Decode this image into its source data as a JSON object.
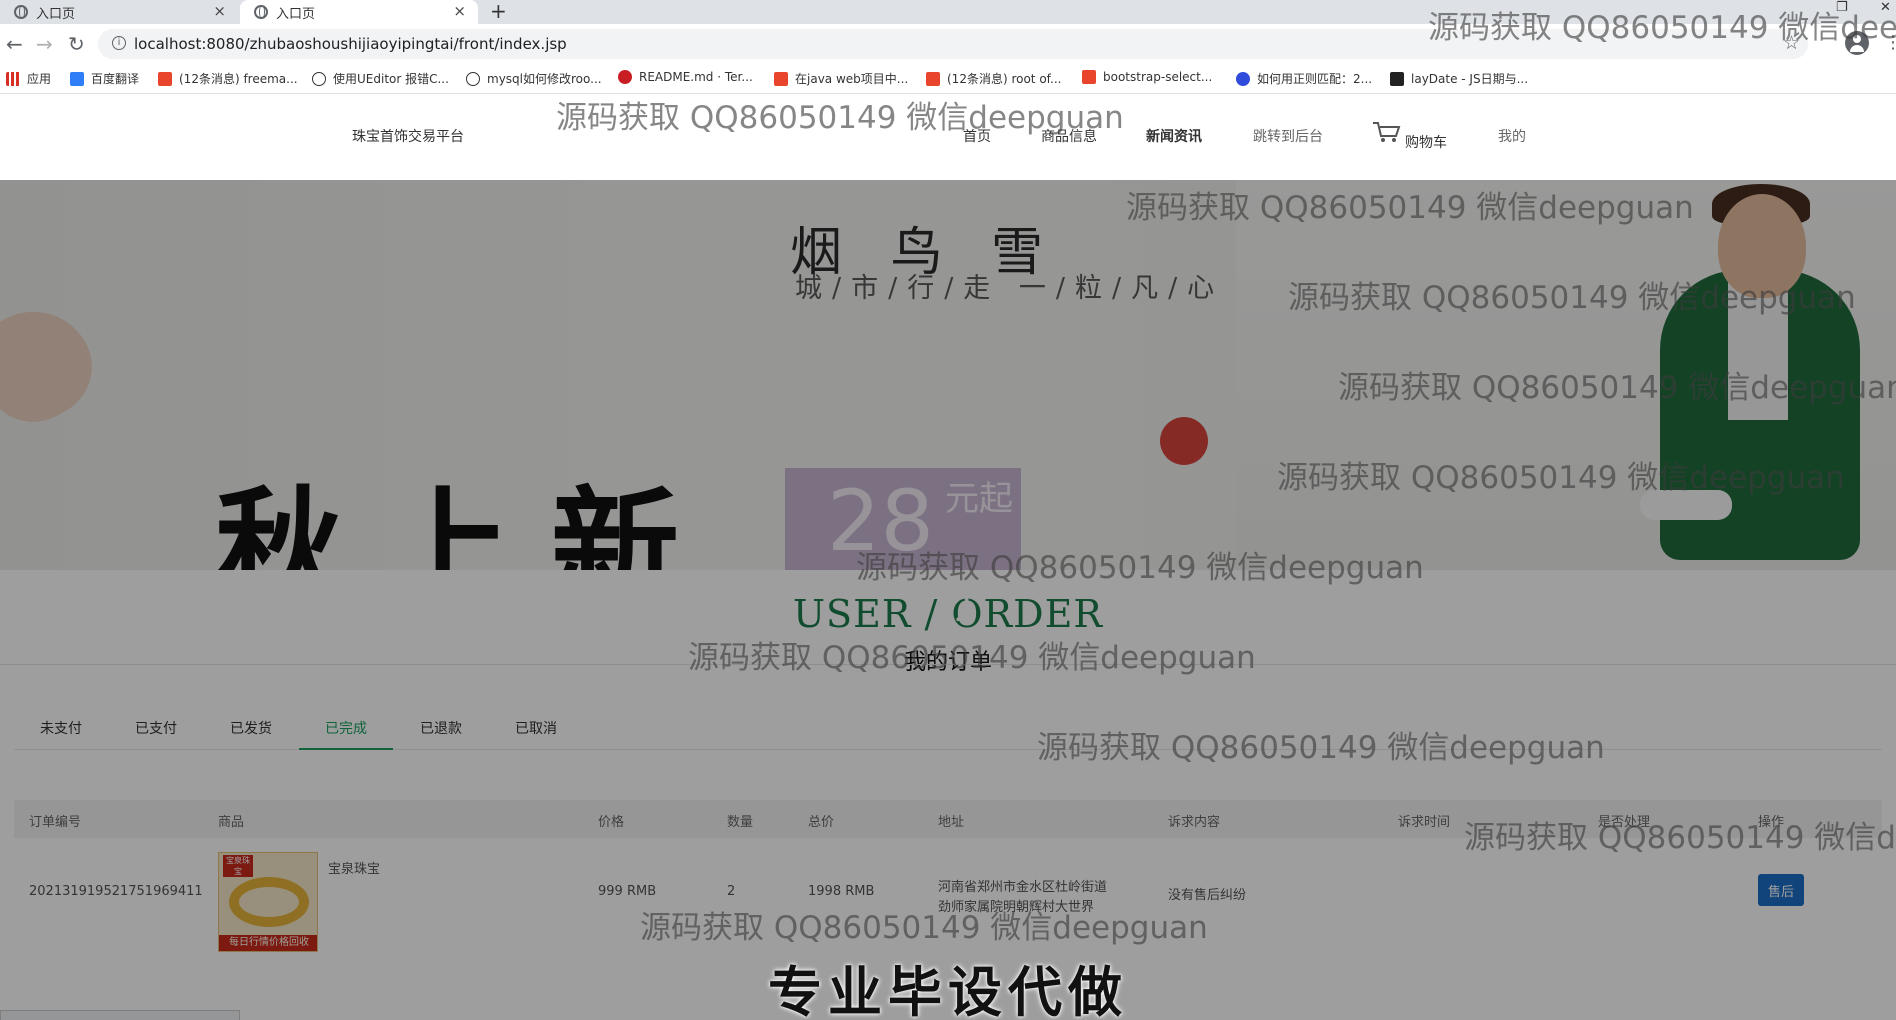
{
  "browser": {
    "tabs": [
      {
        "title": "入口页"
      },
      {
        "title": "入口页"
      }
    ],
    "url": "localhost:8080/zhubaoshoushijiaoyipingtai/front/index.jsp",
    "bookmarks": [
      {
        "label": "应用"
      },
      {
        "label": "百度翻译"
      },
      {
        "label": "(12条消息) freema..."
      },
      {
        "label": "使用UEditor 报错C..."
      },
      {
        "label": "mysql如何修改roo..."
      },
      {
        "label": "README.md · Ter..."
      },
      {
        "label": "在java web项目中..."
      },
      {
        "label": "(12条消息) root of..."
      },
      {
        "label": "bootstrap-select..."
      },
      {
        "label": "如何用正则匹配：2..."
      },
      {
        "label": "layDate - JS日期与..."
      }
    ]
  },
  "site": {
    "brand": "珠宝首饰交易平台",
    "nav": [
      {
        "label": "首页"
      },
      {
        "label": "商品信息"
      },
      {
        "label": "新闻资讯"
      },
      {
        "label": "跳转到后台"
      },
      {
        "label": "购物车"
      },
      {
        "label": "我的"
      }
    ]
  },
  "hero": {
    "brand_line_1": "烟 鸟 雪",
    "brand_line_2": "城/市/行/走  一/粒/凡/心",
    "big_text": "秋上新",
    "price": "28",
    "price_unit": "元起"
  },
  "section": {
    "title_en": "USER / ORDER",
    "title_cn": "我的订单"
  },
  "order_tabs": [
    {
      "label": "未支付"
    },
    {
      "label": "已支付"
    },
    {
      "label": "已发货"
    },
    {
      "label": "已完成",
      "active": true
    },
    {
      "label": "已退款"
    },
    {
      "label": "已取消"
    }
  ],
  "table": {
    "headers": [
      "订单编号",
      "商品",
      "价格",
      "数量",
      "总价",
      "地址",
      "诉求内容",
      "诉求时间",
      "是否处理",
      "操作"
    ],
    "rows": [
      {
        "order_no": "20213191952175196941​1",
        "product_name": "宝泉珠宝",
        "product_img_tag": "宝泉珠宝",
        "product_img_banner": "每日行情价格回收",
        "price": "999 RMB",
        "qty": "2",
        "total": "1998 RMB",
        "address": "河南省郑州市金水区杜岭街道劲师家属院明朝辉村大世界",
        "appeal": "没有售后纠纷",
        "appeal_time": "",
        "handled": "",
        "action": "售后"
      }
    ]
  },
  "overlay": {
    "watermark": "源码获取 QQ86050149 微信deepguan",
    "subtitle": "专业毕设代做"
  },
  "colors": {
    "accent_green": "#1aa15f",
    "title_green": "#1d7b4c",
    "button_blue": "#1e6fc8"
  }
}
